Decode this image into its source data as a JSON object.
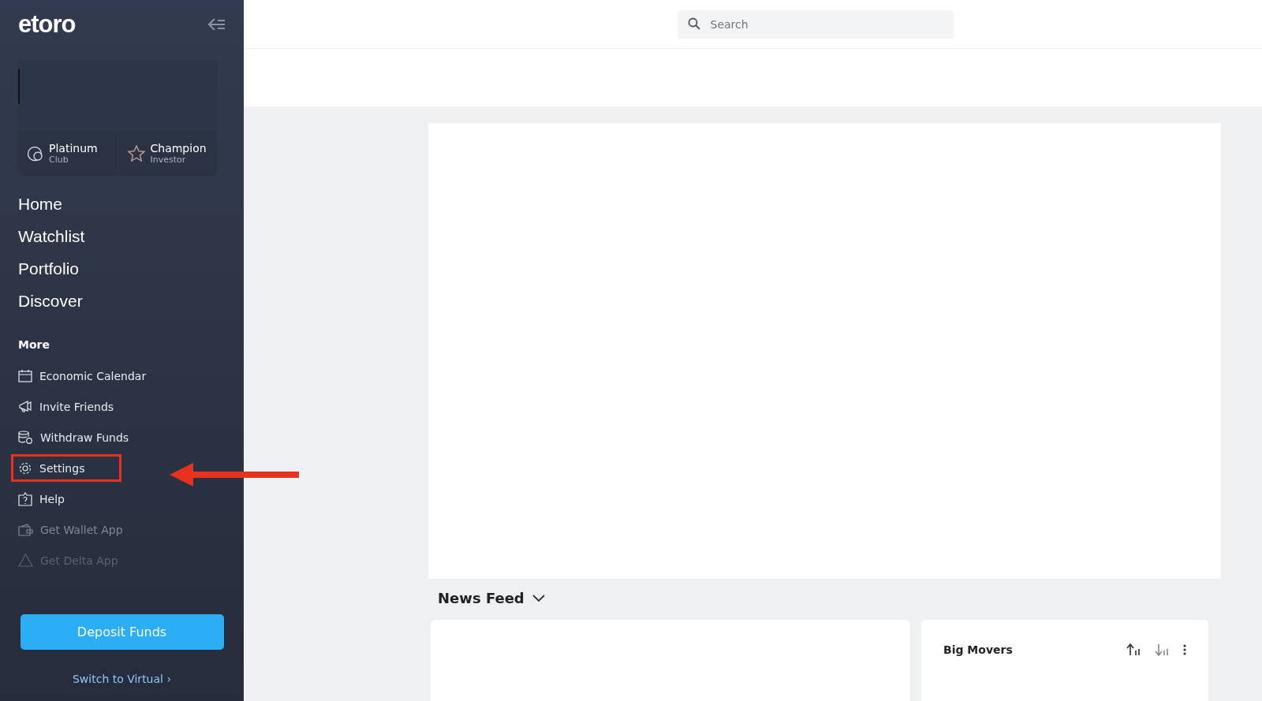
{
  "sidebar": {
    "logo": "etoro",
    "badges": [
      {
        "title": "Platinum",
        "subtitle": "Club"
      },
      {
        "title": "Champion",
        "subtitle": "Investor"
      }
    ],
    "nav": [
      "Home",
      "Watchlist",
      "Portfolio",
      "Discover"
    ],
    "more_heading": "More",
    "more_items": [
      {
        "label": "Economic Calendar",
        "disabled": false,
        "highlighted": false
      },
      {
        "label": "Invite Friends",
        "disabled": false,
        "highlighted": false
      },
      {
        "label": "Withdraw Funds",
        "disabled": false,
        "highlighted": false
      },
      {
        "label": "Settings",
        "disabled": false,
        "highlighted": true
      },
      {
        "label": "Help",
        "disabled": false,
        "highlighted": false
      },
      {
        "label": "Get Wallet App",
        "disabled": true,
        "highlighted": false
      },
      {
        "label": "Get Delta App",
        "disabled": true,
        "highlighted": false
      }
    ],
    "deposit_button": "Deposit Funds",
    "switch_link": "Switch to Virtual ›"
  },
  "search": {
    "placeholder": "Search"
  },
  "news_feed": {
    "title": "News Feed"
  },
  "big_movers": {
    "title": "Big Movers"
  }
}
